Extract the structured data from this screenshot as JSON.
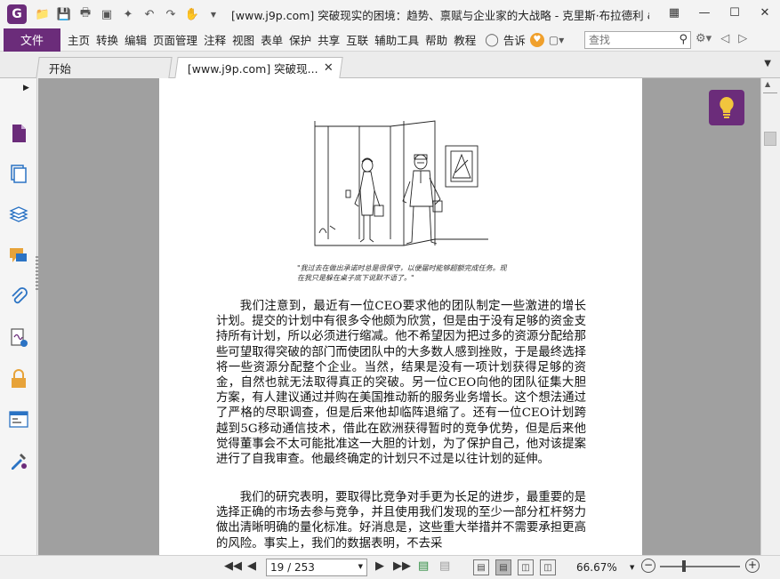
{
  "titlebar": {
    "logo": "G",
    "title": "[www.j9p.com] 突破现实的困境：趋势、禀赋与企业家的大战略 - 克里斯·布拉德利 & ...",
    "qat_icons": [
      "folder-icon",
      "save-icon",
      "print-icon",
      "screen-icon",
      "new-icon",
      "undo-icon",
      "redo-icon",
      "hand-tool-icon"
    ]
  },
  "menubar": {
    "file_label": "文件",
    "items": [
      "主页",
      "转换",
      "编辑",
      "页面管理",
      "注释",
      "视图",
      "表单",
      "保护",
      "共享",
      "互联",
      "辅助工具",
      "帮助",
      "教程"
    ],
    "tell_me": "告诉",
    "search_placeholder": "查找"
  },
  "tabs": [
    {
      "label": "开始"
    },
    {
      "label": "[www.j9p.com] 突破现..."
    }
  ],
  "document": {
    "caption": "\"我过去在做出承诺时总是很保守，以便届时能够超额完成任务。现在我只是躲在桌子底下说默不语了。\"",
    "paragraph1": "我们注意到，最近有一位CEO要求他的团队制定一些激进的增长计划。提交的计划中有很多令他颇为欣赏，但是由于没有足够的资金支持所有计划，所以必须进行缩减。他不希望因为把过多的资源分配给那些可望取得突破的部门而使团队中的大多数人感到挫败，于是最终选择将一些资源分配整个企业。当然，结果是没有一项计划获得足够的资金，自然也就无法取得真正的突破。另一位CEO向他的团队征集大胆方案，有人建议通过并购在美国推动新的服务业务增长。这个想法通过了严格的尽职调查，但是后来他却临阵退缩了。还有一位CEO计划跨越到5G移动通信技术，借此在欧洲获得暂时的竞争优势，但是后来他觉得董事会不太可能批准这一大胆的计划，为了保护自己，他对该提案进行了自我审查。他最终确定的计划只不过是以往计划的延伸。",
    "paragraph2": "我们的研究表明，要取得比竞争对手更为长足的进步，最重要的是选择正确的市场去参与竞争，并且使用我们发现的至少一部分杠杆努力做出清晰明确的量化标准。好消息是，这些重大举措并不需要承担更高的风险。事实上，我们的数据表明，不去采"
  },
  "statusbar": {
    "current_page": "19",
    "page_display": "19 / 253",
    "total_pages": "253",
    "zoom": "66.67%",
    "zoom_fraction": 0.3
  },
  "colors": {
    "accent": "#6b2c7a",
    "doc_background": "#a0a0a0"
  }
}
